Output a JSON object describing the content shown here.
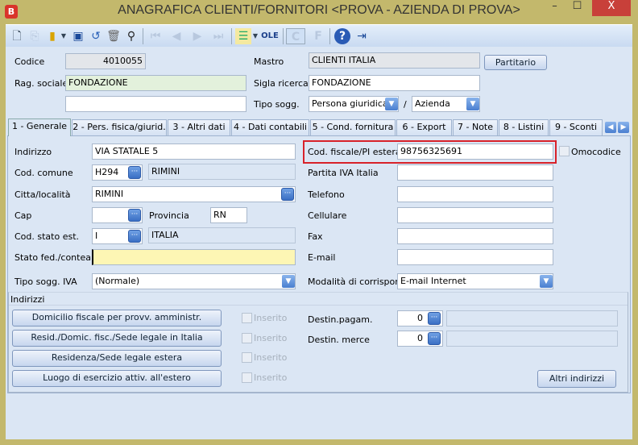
{
  "window": {
    "title": "ANAGRAFICA CLIENTI/FORNITORI <PROVA - AZIENDA DI PROVA>",
    "app_icon": "B",
    "minimize": "–",
    "maximize": "☐",
    "close": "X"
  },
  "toolbar": {
    "icons": [
      "new-document-icon",
      "copy-document-icon",
      "folder-icon",
      "dropdown-icon",
      "save-icon",
      "undo-icon",
      "delete-icon",
      "binoculars-icon",
      "first-icon",
      "previous-icon",
      "next-icon",
      "last-icon",
      "list-icon",
      "ole-icon",
      "c-icon",
      "f-icon",
      "help-icon",
      "exit-icon"
    ],
    "ole_label": "OLE",
    "c_label": "C",
    "f_label": "F",
    "help_label": "?"
  },
  "header": {
    "codice_label": "Codice",
    "codice_value": "4010055",
    "rag_sociale_label": "Rag. sociale",
    "rag_sociale_value": "FONDAZIONE",
    "rag_sociale2_value": "",
    "mastro_label": "Mastro",
    "mastro_value": "CLIENTI ITALIA",
    "partitario_button": "Partitario",
    "sigla_label": "Sigla ricerca",
    "sigla_value": "FONDAZIONE",
    "tipo_sogg_label": "Tipo sogg.",
    "tipo_sogg_value": "Persona giuridica",
    "slash": "/",
    "tipo_sogg2_value": "Azienda"
  },
  "tabs": [
    {
      "label": "1 - Generale",
      "active": true
    },
    {
      "label": "2 - Pers. fisica/giurid."
    },
    {
      "label": "3 - Altri dati"
    },
    {
      "label": "4 - Dati contabili"
    },
    {
      "label": "5 - Cond. fornitura"
    },
    {
      "label": "6 - Export"
    },
    {
      "label": "7 - Note"
    },
    {
      "label": "8 - Listini"
    },
    {
      "label": "9 - Sconti"
    }
  ],
  "generale": {
    "indirizzo_label": "Indirizzo",
    "indirizzo_value": "VIA STATALE 5",
    "cod_comune_label": "Cod. comune",
    "cod_comune_value": "H294",
    "comune_desc": "RIMINI",
    "citta_label": "Citta/località",
    "citta_value": "RIMINI",
    "cap_label": "Cap",
    "cap_value": "",
    "provincia_label": "Provincia",
    "provincia_value": "RN",
    "cod_stato_label": "Cod. stato est.",
    "cod_stato_value": "I",
    "stato_desc": "ITALIA",
    "stato_fed_label": "Stato fed./contea",
    "stato_fed_value": "",
    "tipo_iva_label": "Tipo sogg. IVA",
    "tipo_iva_value": "(Normale)",
    "cod_fiscale_label": "Cod. fiscale/PI estera",
    "cod_fiscale_value": "98756325691",
    "omocodice_label": "Omocodice",
    "partita_iva_label": "Partita IVA Italia",
    "partita_iva_value": "",
    "telefono_label": "Telefono",
    "telefono_value": "",
    "cellulare_label": "Cellulare",
    "cellulare_value": "",
    "fax_label": "Fax",
    "fax_value": "",
    "email_label": "E-mail",
    "email_value": "",
    "modalita_label": "Modalità di corrispond.",
    "modalita_value": "E-mail Internet"
  },
  "indirizzi": {
    "title": "Indirizzi",
    "buttons": [
      "Domicilio fiscale per provv. amministr.",
      "Resid./Domic. fisc./Sede legale in Italia",
      "Residenza/Sede legale estera",
      "Luogo di esercizio attiv. all'estero"
    ],
    "inserito_label": "Inserito",
    "destin_pagam_label": "Destin.pagam.",
    "destin_pagam_value": "0",
    "destin_pagam_desc": "",
    "destin_merce_label": "Destin. merce",
    "destin_merce_value": "0",
    "destin_merce_desc": "",
    "altri_button": "Altri indirizzi"
  }
}
